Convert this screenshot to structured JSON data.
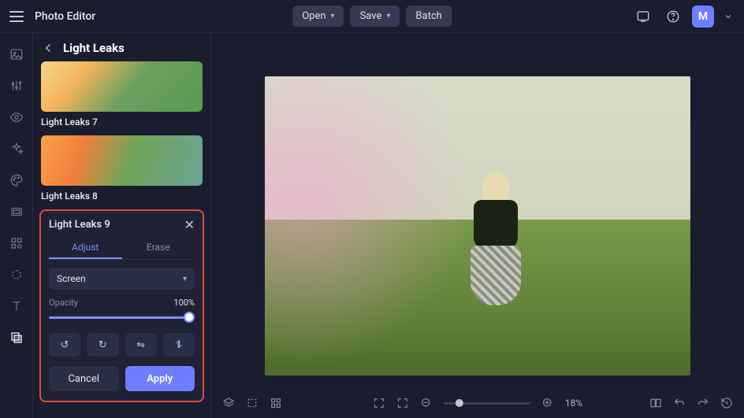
{
  "header": {
    "app_title": "Photo Editor",
    "open_label": "Open",
    "save_label": "Save",
    "batch_label": "Batch",
    "avatar_letter": "M"
  },
  "panel": {
    "title": "Light Leaks",
    "presets": [
      {
        "label": "Light Leaks 7"
      },
      {
        "label": "Light Leaks 8"
      }
    ]
  },
  "effect": {
    "name": "Light Leaks 9",
    "tabs": {
      "adjust": "Adjust",
      "erase": "Erase"
    },
    "blend_mode": "Screen",
    "opacity_label": "Opacity",
    "opacity_value": "100%",
    "cancel_label": "Cancel",
    "apply_label": "Apply"
  },
  "bottom": {
    "zoom_label": "18%"
  }
}
